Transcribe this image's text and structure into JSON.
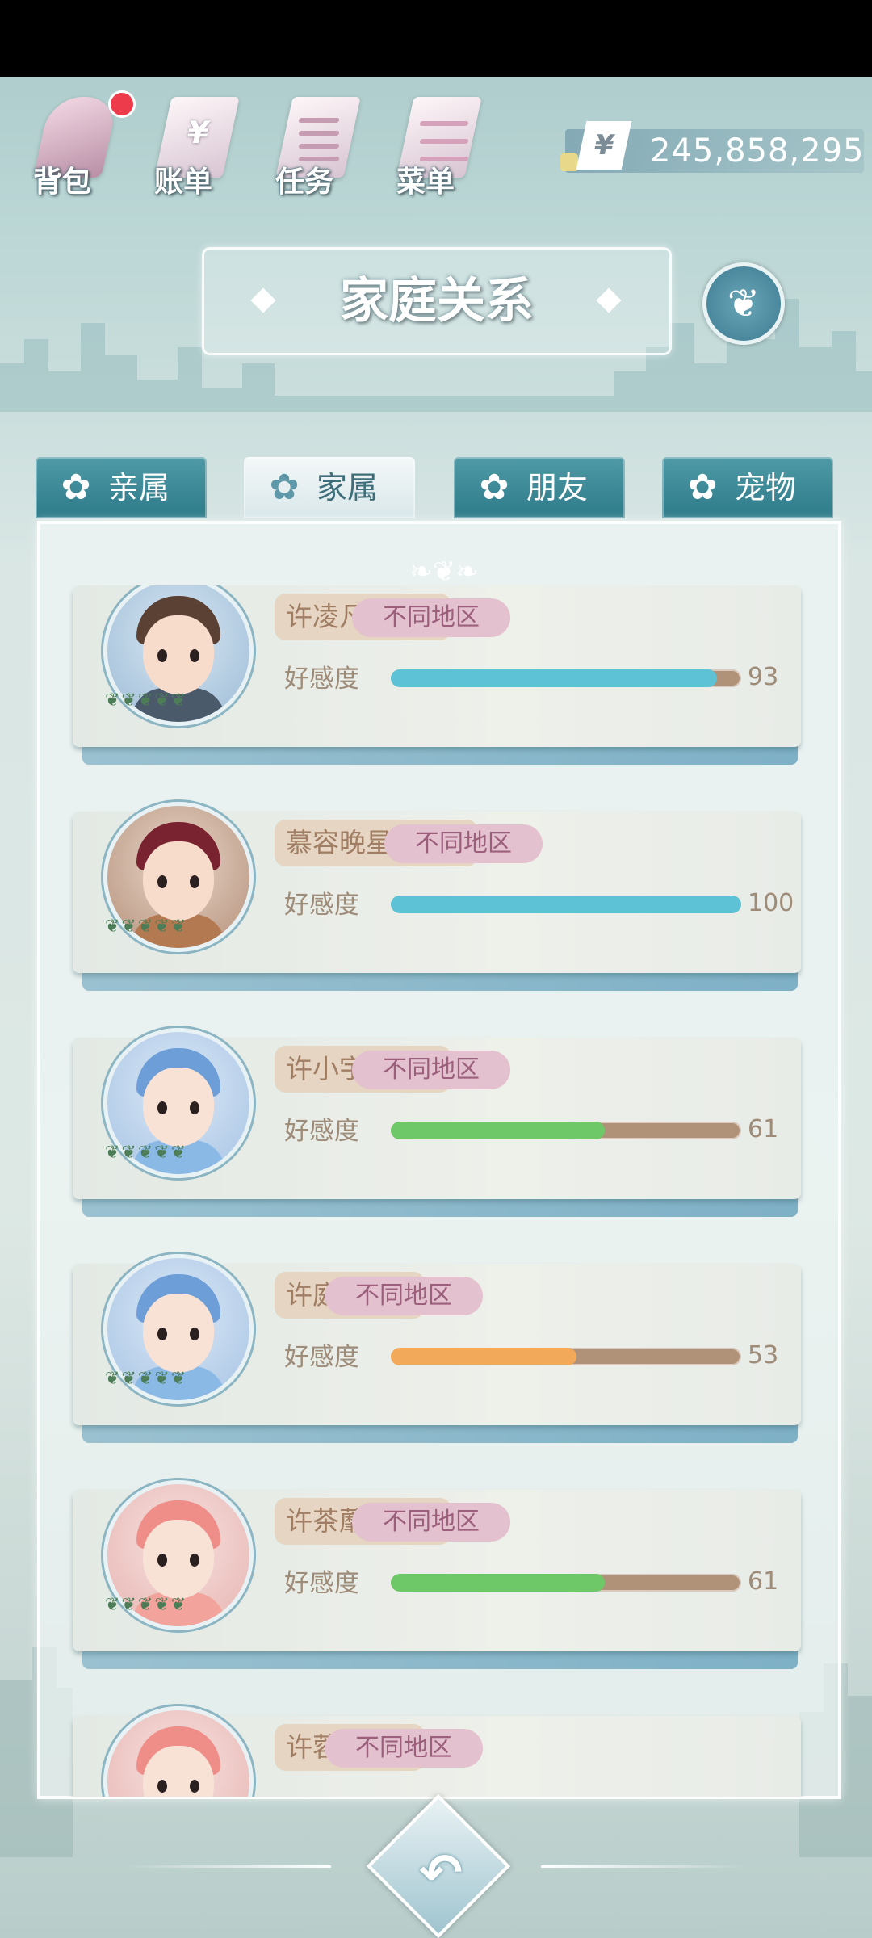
{
  "toolbar": {
    "items": [
      {
        "label": "背包",
        "icon": "bag-icon"
      },
      {
        "label": "账单",
        "icon": "bill-icon"
      },
      {
        "label": "任务",
        "icon": "task-icon"
      },
      {
        "label": "菜单",
        "icon": "menu-icon"
      }
    ],
    "currency_symbol": "¥",
    "money": "245,858,295"
  },
  "title": "家庭关系",
  "tabs": [
    {
      "label": "亲属",
      "active": false
    },
    {
      "label": "家属",
      "active": true
    },
    {
      "label": "朋友",
      "active": false
    },
    {
      "label": "宠物",
      "active": false
    }
  ],
  "affinity_label": "好感度",
  "members": [
    {
      "name": "许凌凡(儿子)",
      "region": "不同地区",
      "affinity": 93,
      "bar_color": "#5ec2d6",
      "avatar": "young-man"
    },
    {
      "name": "慕容晚星(儿媳)",
      "region": "不同地区",
      "affinity": 100,
      "bar_color": "#5ec2d6",
      "avatar": "woman-hat"
    },
    {
      "name": "许小宇(孙子)",
      "region": "不同地区",
      "affinity": 61,
      "bar_color": "#6ec868",
      "avatar": "baby-blue"
    },
    {
      "name": "许庭(孙子)",
      "region": "不同地区",
      "affinity": 53,
      "bar_color": "#f2a95a",
      "avatar": "baby-blue"
    },
    {
      "name": "许茶蘼(孙女)",
      "region": "不同地区",
      "affinity": 61,
      "bar_color": "#6ec868",
      "avatar": "baby-pink"
    },
    {
      "name": "许蓉(孙女)",
      "region": "不同地区",
      "affinity": null,
      "bar_color": "#6ec868",
      "avatar": "baby-pink"
    }
  ],
  "back_icon": "back-arrow-icon"
}
